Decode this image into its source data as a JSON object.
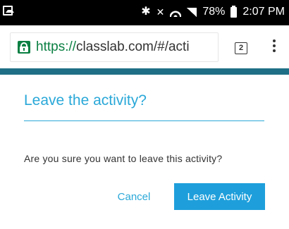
{
  "status_bar": {
    "battery_percent": "78%",
    "time": "2:07 PM",
    "icons": [
      "gallery-icon",
      "bluetooth-icon",
      "mute-icon",
      "wifi-icon",
      "signal-icon",
      "battery-icon"
    ]
  },
  "browser": {
    "url_scheme": "https://",
    "url_rest": "classlab.com/#/acti",
    "tab_count": "2",
    "colors": {
      "lock": "#0b8043",
      "scheme": "#0b8043"
    }
  },
  "dialog": {
    "title": "Leave the activity?",
    "message": "Are you sure you want to leave this activity?",
    "cancel_label": "Cancel",
    "confirm_label": "Leave Activity",
    "colors": {
      "accent": "#2aa8d8",
      "button": "#1e9fdb",
      "band": "#1f6f86"
    }
  }
}
